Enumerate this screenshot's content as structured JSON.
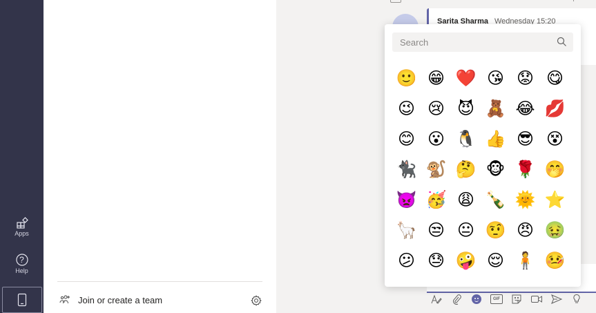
{
  "rail": {
    "apps_label": "Apps",
    "help_label": "Help",
    "help_glyph": "?"
  },
  "panel": {
    "join_label": "Join or create a team"
  },
  "chat": {
    "sender": "Sarita Sharma",
    "timestamp": "Wednesday 15:20"
  },
  "emoji_picker": {
    "search_placeholder": "Search",
    "emojis": [
      [
        "🙂",
        "😁",
        "❤️",
        "😘",
        "😟",
        "😋"
      ],
      [
        "😉",
        "😢",
        "😈",
        "🧸",
        "😂",
        "💋"
      ],
      [
        "😊",
        "😮",
        "🐧",
        "👍",
        "😎",
        "😵"
      ],
      [
        "🐈‍⬛",
        "🐒",
        "🤔",
        "🐵",
        "🌹",
        "🤭"
      ],
      [
        "👿",
        "🥳",
        "😩",
        "🍾",
        "🌞",
        "⭐"
      ],
      [
        "🦙",
        "😒",
        "😐",
        "🤨",
        "😠",
        "🤢"
      ],
      [
        "😕",
        "😓",
        "🤪",
        "😌",
        "🧍",
        "🤒"
      ]
    ]
  },
  "toolbar": {
    "gif_label": "GIF"
  },
  "colors": {
    "rail": "#33344a",
    "accent": "#6264a7",
    "background": "#f3f2f1"
  }
}
